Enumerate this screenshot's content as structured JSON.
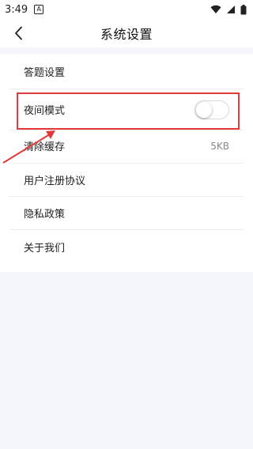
{
  "status_bar": {
    "time": "3:49",
    "notification_glyph": "A"
  },
  "header": {
    "title": "系统设置"
  },
  "settings": {
    "items": [
      {
        "label": "答题设置"
      },
      {
        "label": "夜间模式",
        "toggle_on": false
      },
      {
        "label": "清除缓存",
        "value": "5KB"
      },
      {
        "label": "用户注册协议"
      },
      {
        "label": "隐私政策"
      },
      {
        "label": "关于我们"
      }
    ]
  },
  "colors": {
    "highlight": "#e23a3a",
    "page_bg": "#f5f6fb"
  }
}
